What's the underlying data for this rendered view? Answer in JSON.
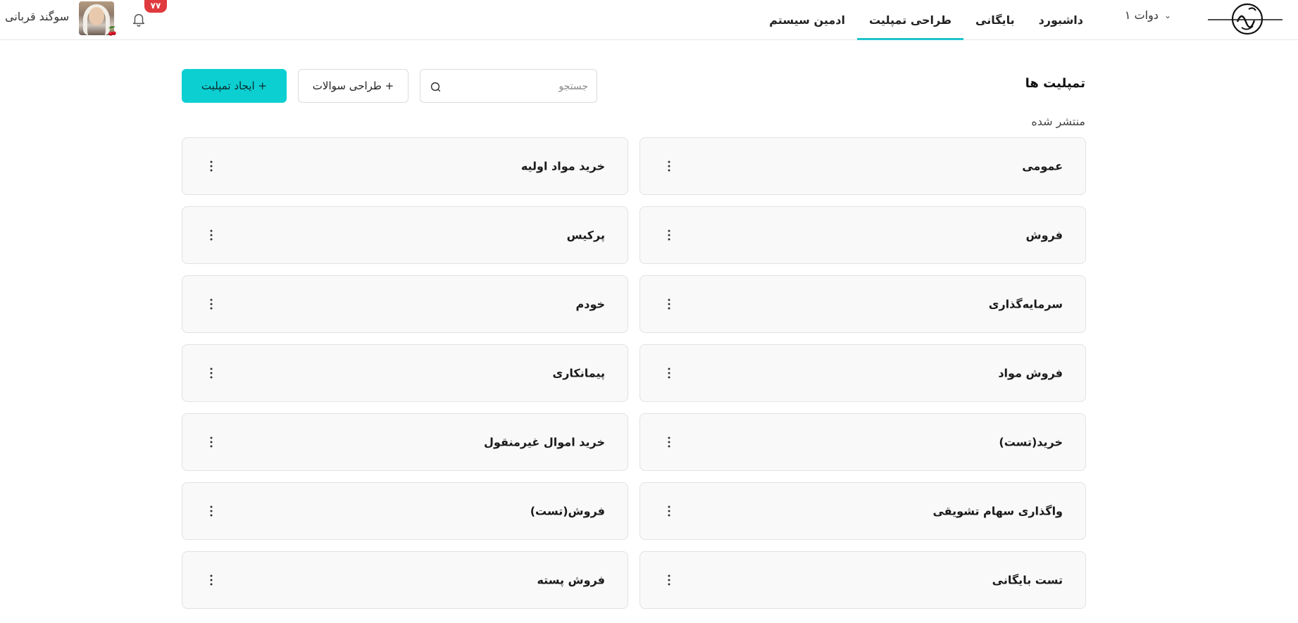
{
  "header": {
    "org_selector": "دوات ۱",
    "nav": [
      {
        "label": "داشبورد",
        "active": false
      },
      {
        "label": "بایگانی",
        "active": false
      },
      {
        "label": "طراحی تمپلیت",
        "active": true
      },
      {
        "label": "ادمین سیستم",
        "active": false
      }
    ],
    "user_name": "سوگند قربانی",
    "notification_count": "۷۷",
    "accent_color": "#1fc3cc"
  },
  "toolbar": {
    "page_title": "تمپلیت ها",
    "section_label": "منتشر شده",
    "search_placeholder": "جستجو",
    "design_questions_label": "+ طراحی سوالات",
    "create_template_label": "+ ایجاد تمپلیت",
    "primary_color": "#0ccfd2"
  },
  "templates": [
    {
      "label": "عمومی"
    },
    {
      "label": "خرید مواد اولیه"
    },
    {
      "label": "فروش"
    },
    {
      "label": "پرکیس"
    },
    {
      "label": "سرمایه‌گذاری"
    },
    {
      "label": "خودم"
    },
    {
      "label": "فروش مواد"
    },
    {
      "label": "پیمانکاری"
    },
    {
      "label": "خرید(تست)"
    },
    {
      "label": "خرید اموال غیرمنقول"
    },
    {
      "label": "واگذاری سهام تشویقی"
    },
    {
      "label": "فروش(تست)"
    },
    {
      "label": "تست بایگانی"
    },
    {
      "label": "فروش پسته"
    }
  ]
}
